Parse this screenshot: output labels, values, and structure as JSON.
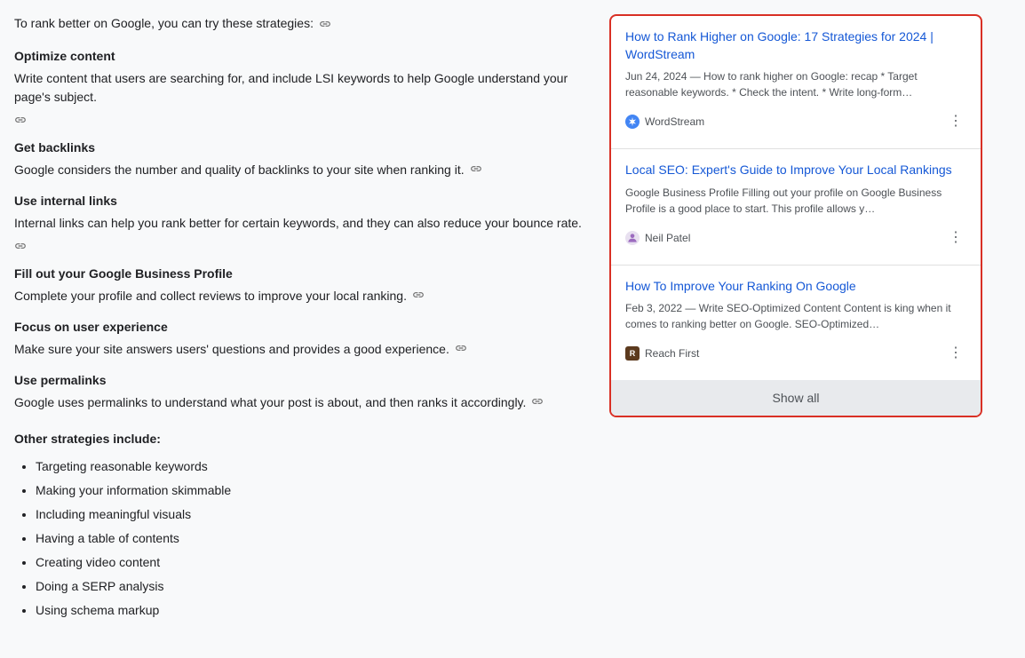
{
  "intro": {
    "text": "To rank better on Google, you can try these strategies:",
    "link_icon": "🔗"
  },
  "strategies": [
    {
      "heading": "Optimize content",
      "description": "Write content that users are searching for, and include LSI keywords to help Google understand your page's subject.",
      "has_link": true
    },
    {
      "heading": "Get backlinks",
      "description": "Google considers the number and quality of backlinks to your site when ranking it.",
      "has_link": true
    },
    {
      "heading": "Use internal links",
      "description": "Internal links can help you rank better for certain keywords, and they can also reduce your bounce rate.",
      "has_link": true
    },
    {
      "heading": "Fill out your Google Business Profile",
      "description": "Complete your profile and collect reviews to improve your local ranking.",
      "has_link": true
    },
    {
      "heading": "Focus on user experience",
      "description": "Make sure your site answers users' questions and provides a good experience.",
      "has_link": true
    },
    {
      "heading": "Use permalinks",
      "description": "Google uses permalinks to understand what your post is about, and then ranks it accordingly.",
      "has_link": true
    }
  ],
  "other_strategies": {
    "heading": "Other strategies include:",
    "items": [
      "Targeting reasonable keywords",
      "Making your information skimmable",
      "Including meaningful visuals",
      "Having a table of contents",
      "Creating video content",
      "Doing a SERP analysis",
      "Using schema markup"
    ]
  },
  "search_results": {
    "items": [
      {
        "title": "How to Rank Higher on Google: 17 Strategies for 2024 | WordStream",
        "snippet": "Jun 24, 2024 — How to rank higher on Google: recap * Target reasonable keywords. * Check the intent. * Write long-form…",
        "source": "WordStream",
        "source_type": "wordstream"
      },
      {
        "title": "Local SEO: Expert's Guide to Improve Your Local Rankings",
        "snippet": "Google Business Profile Filling out your profile on Google Business Profile is a good place to start. This profile allows y…",
        "source": "Neil Patel",
        "source_type": "neil"
      },
      {
        "title": "How To Improve Your Ranking On Google",
        "snippet": "Feb 3, 2022 — Write SEO-Optimized Content Content is king when it comes to ranking better on Google. SEO-Optimized…",
        "source": "Reach First",
        "source_type": "reach"
      }
    ],
    "show_all_label": "Show all"
  }
}
